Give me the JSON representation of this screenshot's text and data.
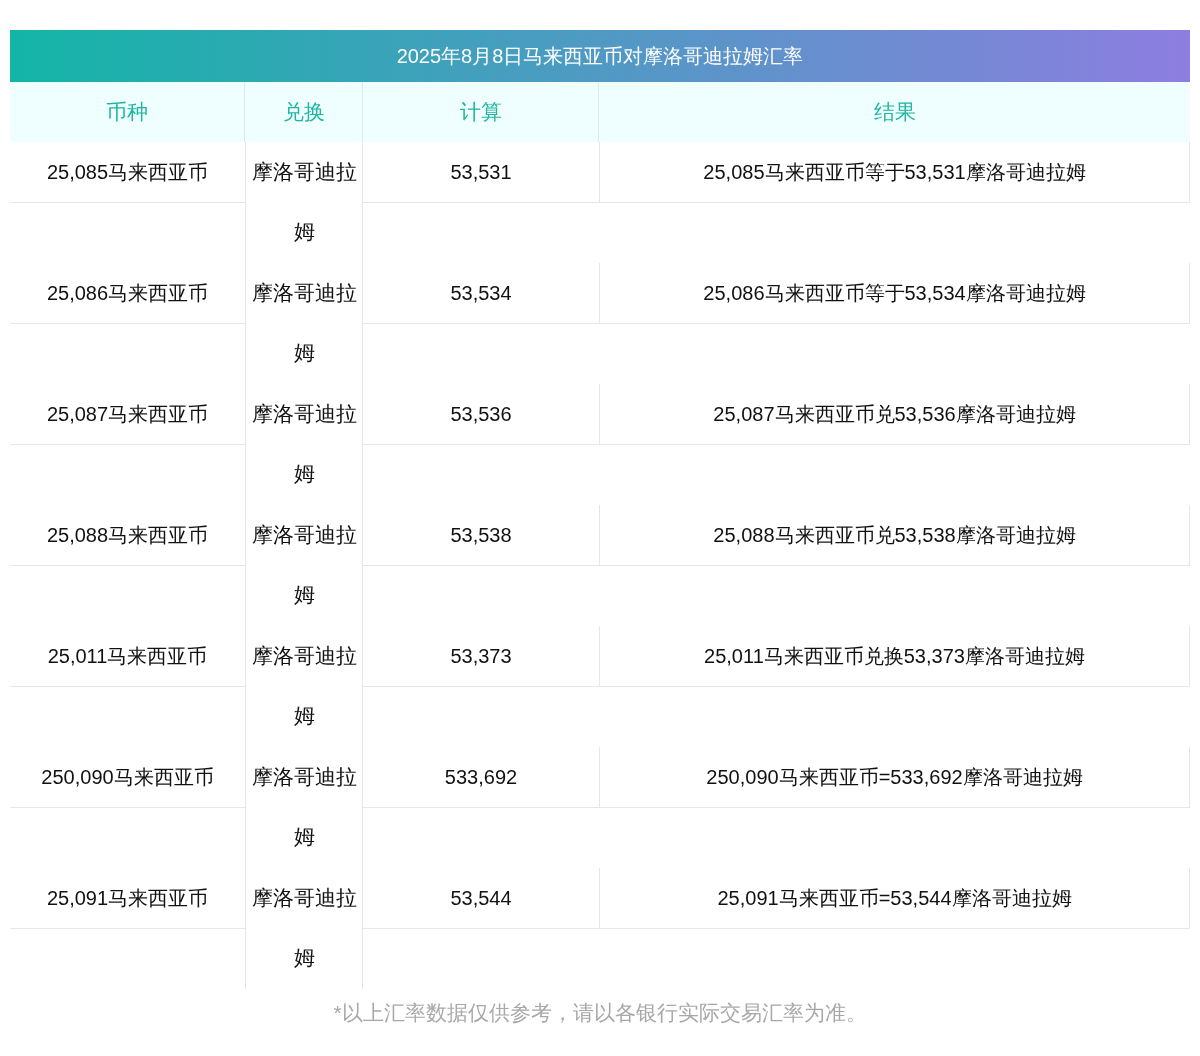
{
  "title": "2025年8月8日马来西亚币对摩洛哥迪拉姆汇率",
  "columns": [
    "币种",
    "兑换",
    "计算",
    "结果"
  ],
  "rows": [
    {
      "currency": "25,085马来西亚币",
      "exchange": "摩洛哥迪拉姆",
      "calc": "53,531",
      "result": "25,085马来西亚币等于53,531摩洛哥迪拉姆"
    },
    {
      "currency": "25,086马来西亚币",
      "exchange": "摩洛哥迪拉姆",
      "calc": "53,534",
      "result": "25,086马来西亚币等于53,534摩洛哥迪拉姆"
    },
    {
      "currency": "25,087马来西亚币",
      "exchange": "摩洛哥迪拉姆",
      "calc": "53,536",
      "result": "25,087马来西亚币兑53,536摩洛哥迪拉姆"
    },
    {
      "currency": "25,088马来西亚币",
      "exchange": "摩洛哥迪拉姆",
      "calc": "53,538",
      "result": "25,088马来西亚币兑53,538摩洛哥迪拉姆"
    },
    {
      "currency": "25,011马来西亚币",
      "exchange": "摩洛哥迪拉姆",
      "calc": "53,373",
      "result": "25,011马来西亚币兑换53,373摩洛哥迪拉姆"
    },
    {
      "currency": "250,090马来西亚币",
      "exchange": "摩洛哥迪拉姆",
      "calc": "533,692",
      "result": "250,090马来西亚币=533,692摩洛哥迪拉姆"
    },
    {
      "currency": "25,091马来西亚币",
      "exchange": "摩洛哥迪拉姆",
      "calc": "53,544",
      "result": "25,091马来西亚币=53,544摩洛哥迪拉姆"
    }
  ],
  "footnote": "*以上汇率数据仅供参考，请以各银行实际交易汇率为准。"
}
